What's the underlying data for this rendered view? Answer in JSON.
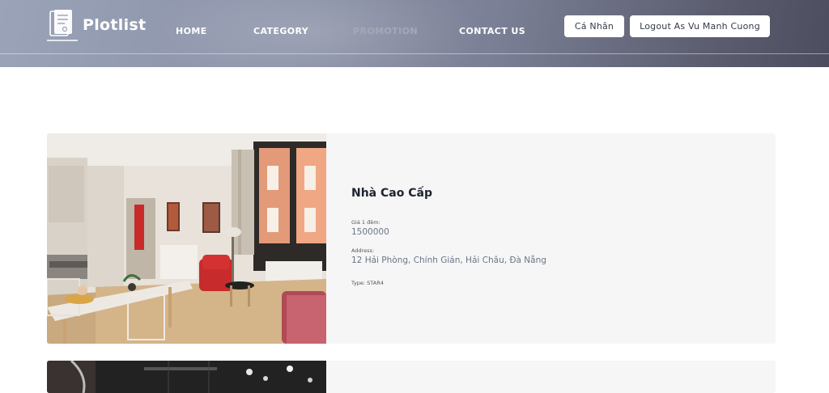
{
  "header": {
    "brand": "Plotlist",
    "nav": [
      {
        "label": "HOME"
      },
      {
        "label": "CATEGORY"
      },
      {
        "label": "PROMOTION"
      },
      {
        "label": "CONTACT US"
      }
    ],
    "profile_button": "Cá Nhân",
    "logout_button": "Logout As Vu Manh Cuong"
  },
  "listings": [
    {
      "title": "Nhà Cao Cấp",
      "price_label": "Giá 1 đêm:",
      "price": "1500000",
      "address_label": "Address:",
      "address": "12 Hải Phòng, Chính Gián, Hải Châu, Đà Nẵng",
      "type_text": "Type: STAR4",
      "image_icon": "apartment-interior-photo"
    },
    {
      "image_icon": "dark-interior-photo"
    }
  ],
  "colors": {
    "header_gradient_start": "#9aa3b8",
    "header_gradient_end": "#4c4d5e",
    "card_background": "#f6f6f6",
    "value_text": "#6b7688"
  }
}
